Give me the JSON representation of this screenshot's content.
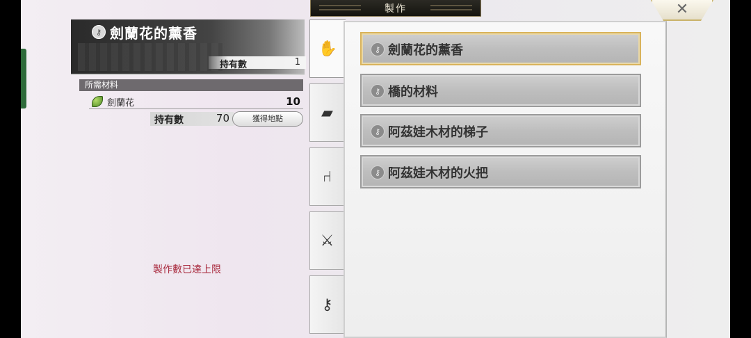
{
  "window": {
    "title": "製作"
  },
  "close": {
    "icon": "close-x-icon",
    "label": "✕"
  },
  "item": {
    "name": "劍蘭花的薰香",
    "owned_label": "持有數",
    "owned_value": "1"
  },
  "materials": {
    "header": "所需材料",
    "items": [
      {
        "name": "劍蘭花",
        "required": "10",
        "owned_label": "持有數",
        "owned_value": "70",
        "source_button": "獲得地點"
      }
    ]
  },
  "status_message": "製作數已達上限",
  "tabs": [
    {
      "icon": "hand-icon",
      "glyph": "✋"
    },
    {
      "icon": "plank-icon",
      "glyph": "▰"
    },
    {
      "icon": "chair-icon",
      "glyph": "⑁"
    },
    {
      "icon": "sword-shield-icon",
      "glyph": "⚔"
    },
    {
      "icon": "key-icon",
      "glyph": "⚷"
    }
  ],
  "recipes": [
    {
      "name": "劍蘭花的薰香",
      "selected": true
    },
    {
      "name": "橋的材料",
      "selected": false
    },
    {
      "name": "阿茲娃木材的梯子",
      "selected": false
    },
    {
      "name": "阿茲娃木材的火把",
      "selected": false
    }
  ],
  "colors": {
    "accent_gold": "#d9b35b",
    "warning_red": "#a8283c",
    "edge_green": "#2e6b3a"
  }
}
